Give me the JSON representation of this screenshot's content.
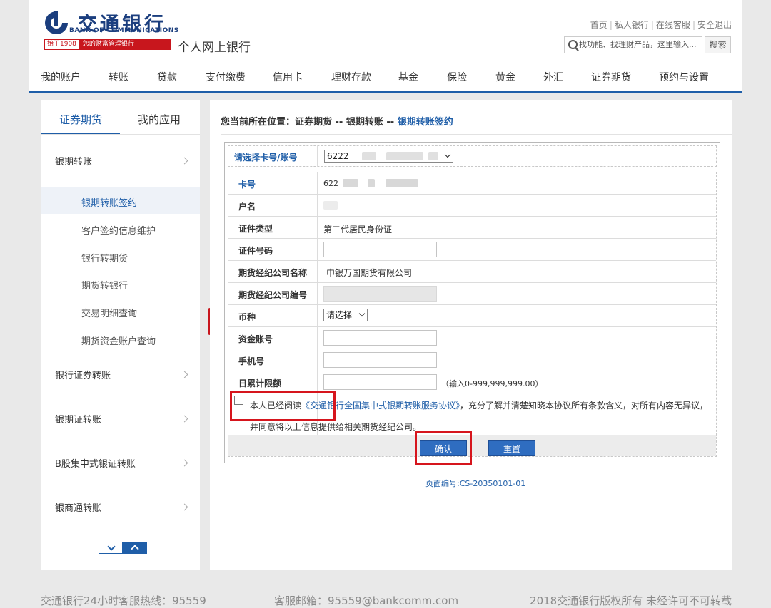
{
  "colors": {
    "brand_blue": "#1f5ea8",
    "brand_red": "#c8161d",
    "highlight_red": "#d6151d"
  },
  "logo": {
    "cn": "交通银行",
    "en": "BANK OF COMMUNICATIONS",
    "slogan_year": "始于1908",
    "slogan": "您的财富管理银行"
  },
  "header": {
    "site_name": "个人网上银行",
    "top_links": [
      "首页",
      "私人银行",
      "在线客服",
      "安全退出"
    ],
    "search_placeholder": "找功能、找理财产品，这里输入...",
    "search_button": "搜索"
  },
  "nav": [
    "我的账户",
    "转账",
    "贷款",
    "支付缴费",
    "信用卡",
    "理财存款",
    "基金",
    "保险",
    "黄金",
    "外汇",
    "证券期货",
    "预约与设置"
  ],
  "sidebar": {
    "tabs": [
      "证券期货",
      "我的应用"
    ],
    "categories": [
      "银期转账",
      "银行证券转账",
      "银期证转账",
      "B股集中式银证转账",
      "银商通转账"
    ],
    "sub_items": [
      "银期转账签约",
      "客户签约信息维护",
      "银行转期货",
      "期货转银行",
      "交易明细查询",
      "期货资金账户查询"
    ]
  },
  "breadcrumb": {
    "prefix": "您当前所在位置：",
    "path": "证券期货 -- 银期转账 -- ",
    "current": "银期转账签约"
  },
  "form": {
    "select_label": "请选择卡号/账号",
    "select_value": "6222",
    "rows": [
      {
        "label": "卡号",
        "value": "622"
      },
      {
        "label": "户名",
        "value": ""
      },
      {
        "label": "证件类型",
        "value": "第二代居民身份证"
      },
      {
        "label": "证件号码",
        "value": ""
      },
      {
        "label": "期货经纪公司名称",
        "value": "申银万国期货有限公司"
      },
      {
        "label": "期货经纪公司编号",
        "value": ""
      },
      {
        "label": "币种",
        "value": "请选择"
      },
      {
        "label": "资金账号",
        "value": ""
      },
      {
        "label": "手机号",
        "value": ""
      },
      {
        "label": "日累计限额",
        "value": ""
      }
    ],
    "limit_hint": "（输入0-999,999,999.00）",
    "agree_prefix": "本人已经阅读",
    "agree_link": "《交通银行全国集中式银期转账服务协议》",
    "agree_suffix": "，充分了解并清楚知晓本协议所有条款含义，对所有内容无异议，并同意将以上信息提供给相关期货经纪公司。",
    "confirm_button": "确认",
    "reset_button": "重置"
  },
  "page_code": "页面编号:CS-20350101-01",
  "footer": {
    "hotline": "交通银行24小时客服热线：95559",
    "email": "客服邮箱：95559@bankcomm.com",
    "copyright": "2018交通银行版权所有 未经许可不可转载"
  }
}
